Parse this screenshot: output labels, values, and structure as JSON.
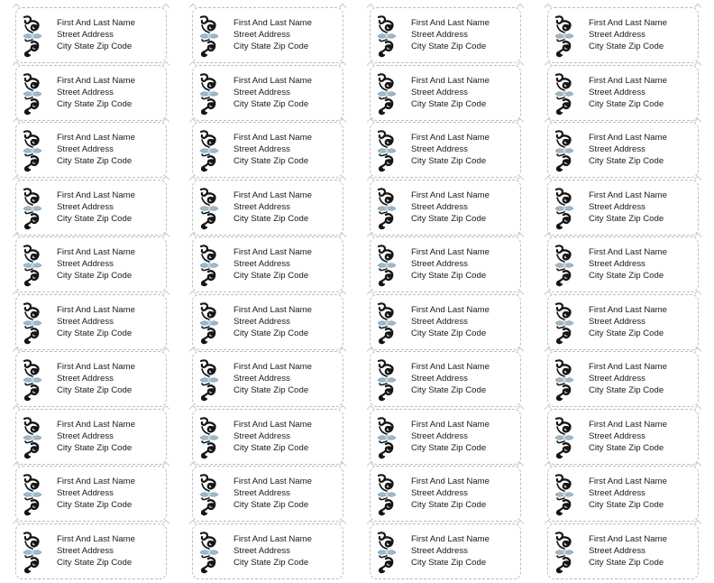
{
  "document": {
    "type": "address-label-sheet",
    "columns": 4,
    "rows": 10
  },
  "label_template": {
    "ornament_icon": "scroll-flourish-ornament",
    "line1": "First And Last Name",
    "line2": "Street Address",
    "line3": "City State Zip Code"
  },
  "colors": {
    "ornament_dark": "#151515",
    "ornament_accent": "#9fb9c9",
    "border": "#b9bcc4",
    "text": "#1a1a1a"
  },
  "labels": [
    {
      "line1": "First And Last Name",
      "line2": "Street Address",
      "line3": "City State Zip Code"
    },
    {
      "line1": "First And Last Name",
      "line2": "Street Address",
      "line3": "City State Zip Code"
    },
    {
      "line1": "First And Last Name",
      "line2": "Street Address",
      "line3": "City State Zip Code"
    },
    {
      "line1": "First And Last Name",
      "line2": "Street Address",
      "line3": "City State Zip Code"
    },
    {
      "line1": "First And Last Name",
      "line2": "Street Address",
      "line3": "City State Zip Code"
    },
    {
      "line1": "First And Last Name",
      "line2": "Street Address",
      "line3": "City State Zip Code"
    },
    {
      "line1": "First And Last Name",
      "line2": "Street Address",
      "line3": "City State Zip Code"
    },
    {
      "line1": "First And Last Name",
      "line2": "Street Address",
      "line3": "City State Zip Code"
    },
    {
      "line1": "First And Last Name",
      "line2": "Street Address",
      "line3": "City State Zip Code"
    },
    {
      "line1": "First And Last Name",
      "line2": "Street Address",
      "line3": "City State Zip Code"
    },
    {
      "line1": "First And Last Name",
      "line2": "Street Address",
      "line3": "City State Zip Code"
    },
    {
      "line1": "First And Last Name",
      "line2": "Street Address",
      "line3": "City State Zip Code"
    },
    {
      "line1": "First And Last Name",
      "line2": "Street Address",
      "line3": "City State Zip Code"
    },
    {
      "line1": "First And Last Name",
      "line2": "Street Address",
      "line3": "City State Zip Code"
    },
    {
      "line1": "First And Last Name",
      "line2": "Street Address",
      "line3": "City State Zip Code"
    },
    {
      "line1": "First And Last Name",
      "line2": "Street Address",
      "line3": "City State Zip Code"
    },
    {
      "line1": "First And Last Name",
      "line2": "Street Address",
      "line3": "City State Zip Code"
    },
    {
      "line1": "First And Last Name",
      "line2": "Street Address",
      "line3": "City State Zip Code"
    },
    {
      "line1": "First And Last Name",
      "line2": "Street Address",
      "line3": "City State Zip Code"
    },
    {
      "line1": "First And Last Name",
      "line2": "Street Address",
      "line3": "City State Zip Code"
    },
    {
      "line1": "First And Last Name",
      "line2": "Street Address",
      "line3": "City State Zip Code"
    },
    {
      "line1": "First And Last Name",
      "line2": "Street Address",
      "line3": "City State Zip Code"
    },
    {
      "line1": "First And Last Name",
      "line2": "Street Address",
      "line3": "City State Zip Code"
    },
    {
      "line1": "First And Last Name",
      "line2": "Street Address",
      "line3": "City State Zip Code"
    },
    {
      "line1": "First And Last Name",
      "line2": "Street Address",
      "line3": "City State Zip Code"
    },
    {
      "line1": "First And Last Name",
      "line2": "Street Address",
      "line3": "City State Zip Code"
    },
    {
      "line1": "First And Last Name",
      "line2": "Street Address",
      "line3": "City State Zip Code"
    },
    {
      "line1": "First And Last Name",
      "line2": "Street Address",
      "line3": "City State Zip Code"
    },
    {
      "line1": "First And Last Name",
      "line2": "Street Address",
      "line3": "City State Zip Code"
    },
    {
      "line1": "First And Last Name",
      "line2": "Street Address",
      "line3": "City State Zip Code"
    },
    {
      "line1": "First And Last Name",
      "line2": "Street Address",
      "line3": "City State Zip Code"
    },
    {
      "line1": "First And Last Name",
      "line2": "Street Address",
      "line3": "City State Zip Code"
    },
    {
      "line1": "First And Last Name",
      "line2": "Street Address",
      "line3": "City State Zip Code"
    },
    {
      "line1": "First And Last Name",
      "line2": "Street Address",
      "line3": "City State Zip Code"
    },
    {
      "line1": "First And Last Name",
      "line2": "Street Address",
      "line3": "City State Zip Code"
    },
    {
      "line1": "First And Last Name",
      "line2": "Street Address",
      "line3": "City State Zip Code"
    },
    {
      "line1": "First And Last Name",
      "line2": "Street Address",
      "line3": "City State Zip Code"
    },
    {
      "line1": "First And Last Name",
      "line2": "Street Address",
      "line3": "City State Zip Code"
    },
    {
      "line1": "First And Last Name",
      "line2": "Street Address",
      "line3": "City State Zip Code"
    },
    {
      "line1": "First And Last Name",
      "line2": "Street Address",
      "line3": "City State Zip Code"
    }
  ]
}
